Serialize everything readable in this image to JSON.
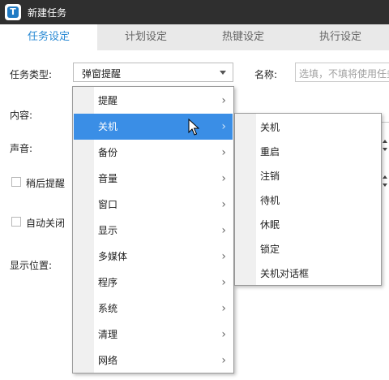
{
  "window": {
    "title": "新建任务"
  },
  "tabs": [
    {
      "label": "任务设定",
      "active": true
    },
    {
      "label": "计划设定",
      "active": false
    },
    {
      "label": "热键设定",
      "active": false
    },
    {
      "label": "执行设定",
      "active": false
    }
  ],
  "form": {
    "task_type_label": "任务类型:",
    "task_type_value": "弹窗提醒",
    "name_label": "名称:",
    "name_placeholder": "选填，不填将使用任务",
    "content_label": "内容:",
    "sound_label": "声音:",
    "remind_later_label": "稍后提醒",
    "auto_close_label": "自动关闭",
    "position_label": "显示位置:"
  },
  "menu": {
    "items": [
      {
        "label": "提醒"
      },
      {
        "label": "关机",
        "highlighted": true
      },
      {
        "label": "备份"
      },
      {
        "label": "音量"
      },
      {
        "label": "窗口"
      },
      {
        "label": "显示"
      },
      {
        "label": "多媒体"
      },
      {
        "label": "程序"
      },
      {
        "label": "系统"
      },
      {
        "label": "清理"
      },
      {
        "label": "网络"
      }
    ]
  },
  "submenu": {
    "items": [
      {
        "label": "关机"
      },
      {
        "label": "重启"
      },
      {
        "label": "注销"
      },
      {
        "label": "待机"
      },
      {
        "label": "休眠"
      },
      {
        "label": "锁定"
      },
      {
        "label": "关机对话框"
      }
    ]
  },
  "colors": {
    "accent": "#3a8ee6",
    "titlebar": "#2f2f2f",
    "active_tab_text": "#2a8ad4"
  }
}
